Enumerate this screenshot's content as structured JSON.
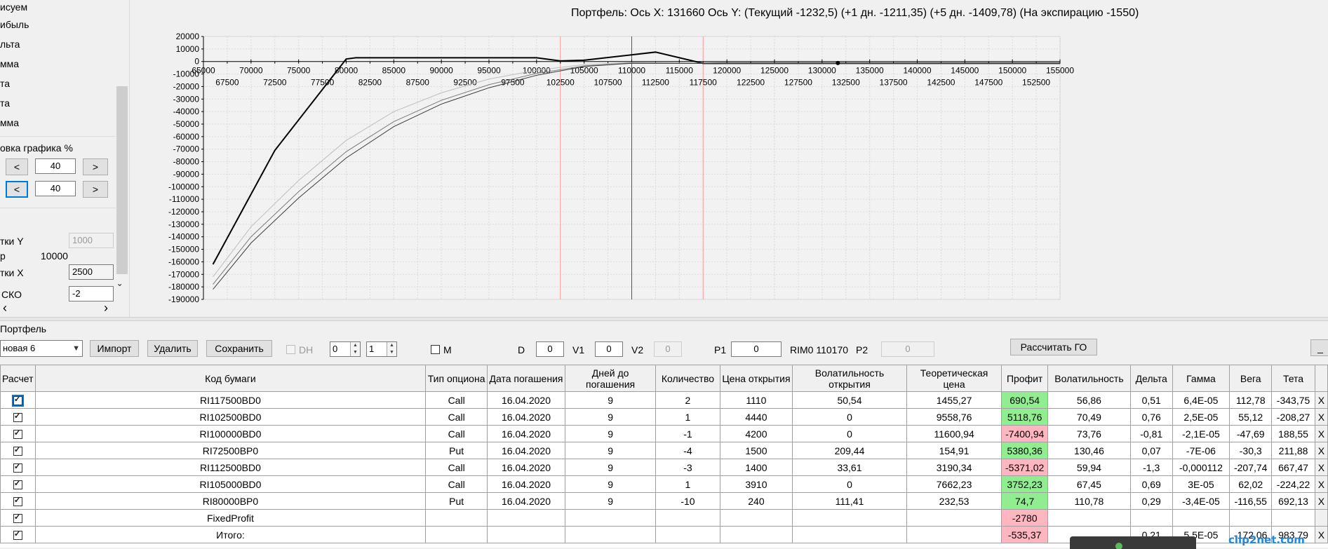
{
  "left_panel": {
    "items": [
      "исуем",
      "ибыль",
      "льта",
      "мма",
      "та",
      "та",
      "мма"
    ],
    "scale_label": "овка графика %",
    "row1": {
      "dec": "<",
      "value": "40",
      "inc": ">"
    },
    "row2": {
      "dec": "<",
      "value": "40",
      "inc": ">"
    },
    "grid_y_label": "тки Y",
    "grid_y_value": "1000",
    "p_label": "р",
    "p_value": "10000",
    "grid_x_label": "тки X",
    "grid_x_value": "2500",
    "sko_label": "СКО",
    "sko_value": "-2",
    "scroll_up": "ˆ",
    "scroll_down": "ˇ",
    "scroll_left": "‹",
    "scroll_right": "›"
  },
  "chart_title": "Портфель: Ось X: 131660 Ось Y:  (Текущий -1232,5)  (+1 дн. -1211,35)  (+5 дн. -1409,78)  (На экспирацию -1550)",
  "chart_data": {
    "type": "line",
    "xlim": [
      65000,
      155000
    ],
    "ylim": [
      -190000,
      20000
    ],
    "x_ticks_top": [
      65000,
      70000,
      75000,
      80000,
      85000,
      90000,
      95000,
      100000,
      105000,
      110000,
      115000,
      120000,
      125000,
      130000,
      135000,
      140000,
      145000,
      150000,
      155000
    ],
    "x_ticks_bottom": [
      67500,
      72500,
      77500,
      82500,
      87500,
      92500,
      97500,
      102500,
      107500,
      112500,
      117500,
      122500,
      127500,
      132500,
      137500,
      142500,
      147500,
      152500
    ],
    "y_ticks": [
      20000,
      10000,
      0,
      -10000,
      -20000,
      -30000,
      -40000,
      -50000,
      -60000,
      -70000,
      -80000,
      -90000,
      -100000,
      -110000,
      -120000,
      -130000,
      -140000,
      -150000,
      -160000,
      -170000,
      -180000,
      -190000
    ],
    "grid": true,
    "red_lines_x": [
      102500,
      117500
    ],
    "cursor_x": 110000,
    "series": [
      {
        "color": "#000000",
        "x": [
          66000,
          72500,
          80000,
          81000,
          100000,
          102500,
          105000,
          112500,
          117500,
          155000
        ],
        "y": [
          -162000,
          -71000,
          2000,
          3000,
          3000,
          500,
          1000,
          7500,
          -1500,
          -1500
        ]
      },
      {
        "color": "#bdbdbd",
        "x": [
          66000,
          70000,
          75000,
          80000,
          85000,
          90000,
          95000,
          100000,
          105000,
          110000,
          115000,
          120000,
          155000
        ],
        "y": [
          -172000,
          -132000,
          -95000,
          -63000,
          -40000,
          -25000,
          -14000,
          -7000,
          -2500,
          -800,
          -1200,
          -1600,
          -1600
        ]
      },
      {
        "color": "#7a7a7a",
        "x": [
          66000,
          70000,
          75000,
          80000,
          85000,
          90000,
          95000,
          100000,
          105000,
          110000,
          115000,
          120000,
          155000
        ],
        "y": [
          -178000,
          -140000,
          -104000,
          -72000,
          -48000,
          -31000,
          -18500,
          -9500,
          -3500,
          -1200,
          -1400,
          -1600,
          -1600
        ]
      },
      {
        "color": "#3c3c3c",
        "x": [
          66000,
          70000,
          75000,
          80000,
          85000,
          90000,
          95000,
          100000,
          105000,
          110000,
          115000,
          120000,
          155000
        ],
        "y": [
          -182000,
          -145000,
          -109000,
          -77000,
          -52000,
          -34000,
          -21000,
          -11000,
          -4000,
          -1400,
          -1500,
          -1600,
          -1600
        ]
      }
    ],
    "marker": {
      "x": 131660,
      "y": -1232.5
    }
  },
  "toolbar": {
    "portfolio_label": "Портфель",
    "portfolio_select": "новая 6",
    "import": "Импорт",
    "delete": "Удалить",
    "save": "Сохранить",
    "dh": "DH",
    "spin1": "0",
    "spin2": "1",
    "m": "M",
    "d_label": "D",
    "d_value": "0",
    "v1_label": "V1",
    "v1_value": "0",
    "v2_label": "V2",
    "v2_value": "0",
    "p1_label": "P1",
    "p1_value": "0",
    "rim_label": "RIM0 110170",
    "p2_label": "P2",
    "p2_value": "0",
    "calc_go": "Рассчитать ГО",
    "minimize": "_"
  },
  "table": {
    "headers": [
      "Расчет",
      "Код бумаги",
      "Тип опциона",
      "Дата погашения",
      "Дней до погашения",
      "Количество",
      "Цена открытия",
      "Волатильность открытия",
      "Теоретическая цена",
      "Профит",
      "Волатильность",
      "Дельта",
      "Гамма",
      "Вега",
      "Тета",
      ""
    ],
    "rows": [
      {
        "code": "RI117500BD0",
        "type": "Call",
        "date": "16.04.2020",
        "days": "9",
        "qty": "2",
        "price": "1110",
        "vol_open": "50,54",
        "theo": "1455,27",
        "profit": "690,54",
        "profit_color": "green",
        "vol": "56,86",
        "delta": "0,51",
        "gamma": "6,4E-05",
        "vega": "112,78",
        "theta": "-343,75",
        "x": "X"
      },
      {
        "code": "RI102500BD0",
        "type": "Call",
        "date": "16.04.2020",
        "days": "9",
        "qty": "1",
        "price": "4440",
        "vol_open": "0",
        "theo": "9558,76",
        "profit": "5118,76",
        "profit_color": "green",
        "vol": "70,49",
        "delta": "0,76",
        "gamma": "2,5E-05",
        "vega": "55,12",
        "theta": "-208,27",
        "x": "X"
      },
      {
        "code": "RI100000BD0",
        "type": "Call",
        "date": "16.04.2020",
        "days": "9",
        "qty": "-1",
        "price": "4200",
        "vol_open": "0",
        "theo": "11600,94",
        "profit": "-7400,94",
        "profit_color": "red",
        "vol": "73,76",
        "delta": "-0,81",
        "gamma": "-2,1E-05",
        "vega": "-47,69",
        "theta": "188,55",
        "x": "X"
      },
      {
        "code": "RI72500BP0",
        "type": "Put",
        "date": "16.04.2020",
        "days": "9",
        "qty": "-4",
        "price": "1500",
        "vol_open": "209,44",
        "theo": "154,91",
        "profit": "5380,36",
        "profit_color": "green",
        "vol": "130,46",
        "delta": "0,07",
        "gamma": "-7E-06",
        "vega": "-30,3",
        "theta": "211,88",
        "x": "X"
      },
      {
        "code": "RI112500BD0",
        "type": "Call",
        "date": "16.04.2020",
        "days": "9",
        "qty": "-3",
        "price": "1400",
        "vol_open": "33,61",
        "theo": "3190,34",
        "profit": "-5371,02",
        "profit_color": "red",
        "vol": "59,94",
        "delta": "-1,3",
        "gamma": "-0,000112",
        "vega": "-207,74",
        "theta": "667,47",
        "x": "X"
      },
      {
        "code": "RI105000BD0",
        "type": "Call",
        "date": "16.04.2020",
        "days": "9",
        "qty": "1",
        "price": "3910",
        "vol_open": "0",
        "theo": "7662,23",
        "profit": "3752,23",
        "profit_color": "green",
        "vol": "67,45",
        "delta": "0,69",
        "gamma": "3E-05",
        "vega": "62,02",
        "theta": "-224,22",
        "x": "X"
      },
      {
        "code": "RI80000BP0",
        "type": "Put",
        "date": "16.04.2020",
        "days": "9",
        "qty": "-10",
        "price": "240",
        "vol_open": "111,41",
        "theo": "232,53",
        "profit": "74,7",
        "profit_color": "green",
        "vol": "110,78",
        "delta": "0,29",
        "gamma": "-3,4E-05",
        "vega": "-116,55",
        "theta": "692,13",
        "x": "X"
      },
      {
        "code": "FixedProfit",
        "type": "",
        "date": "",
        "days": "",
        "qty": "",
        "price": "",
        "vol_open": "",
        "theo": "",
        "profit": "-2780",
        "profit_color": "red",
        "vol": "",
        "delta": "",
        "gamma": "",
        "vega": "",
        "theta": "",
        "x": ""
      },
      {
        "code": "Итого:",
        "type": "",
        "date": "",
        "days": "",
        "qty": "",
        "price": "",
        "vol_open": "",
        "theo": "",
        "profit": "-535,37",
        "profit_color": "red",
        "vol": "",
        "delta": "0,21",
        "gamma": "5,5E-05",
        "vega": "-172,06",
        "theta": "983,79",
        "x": "X"
      }
    ]
  },
  "watermark": "clip2net.com"
}
